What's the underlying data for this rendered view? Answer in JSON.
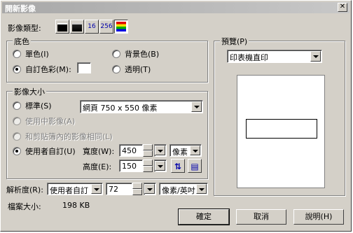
{
  "window": {
    "title": "開新影像",
    "close": "✕"
  },
  "image_type": {
    "label": "影像類型:",
    "buttons": [
      "黑白",
      "灰階",
      "16",
      "256",
      "全彩"
    ]
  },
  "background": {
    "group_label": "底色",
    "mono": "單色(I)",
    "bgcolor": "背景色(B)",
    "custom": "自訂色彩(M):",
    "transparent": "透明(T)"
  },
  "size": {
    "group_label": "影像大小",
    "standard": "標準(S)",
    "standard_value": "網頁 750 x 550 像素",
    "in_use": "使用中影像(A)",
    "clipboard": "和剪貼簿內的影像相同(L)",
    "user": "使用者自訂(U)",
    "width_label": "寬度(W):",
    "width_value": "450",
    "unit": "像素",
    "height_label": "高度(E):",
    "height_value": "150"
  },
  "resolution": {
    "label": "解析度(R):",
    "mode": "使用者自訂",
    "value": "72",
    "unit": "像素/英吋"
  },
  "file_size": {
    "label": "檔案大小:",
    "value": "198 KB"
  },
  "preview": {
    "group_label": "預覽(P)",
    "printer": "印表機直印"
  },
  "buttons": {
    "ok": "確定",
    "cancel": "取消",
    "help": "說明(H)"
  }
}
